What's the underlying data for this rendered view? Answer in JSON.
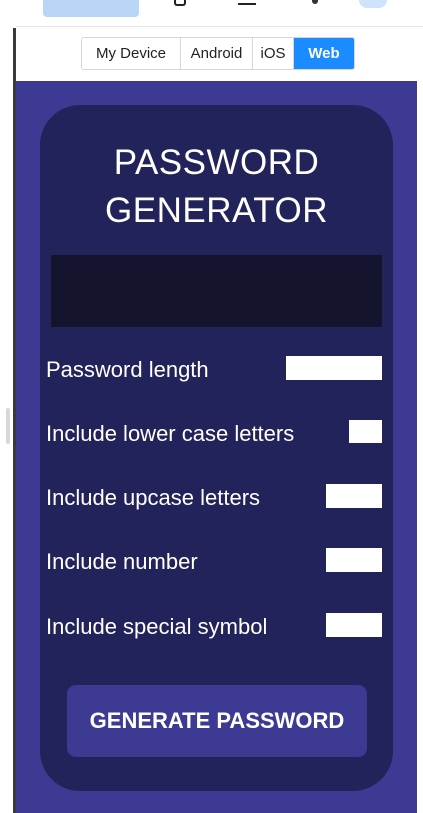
{
  "device_selector": {
    "options": [
      "My Device",
      "Android",
      "iOS",
      "Web"
    ],
    "selected": "Web"
  },
  "app": {
    "title_line1": "PASSWORD",
    "title_line2": "GENERATOR",
    "password_output": "",
    "options": {
      "length_label": "Password length",
      "lowercase_label": "Include lower case letters",
      "upcase_label": "Include upcase letters",
      "number_label": "Include number",
      "symbol_label": "Include special symbol"
    },
    "generate_button": "GENERATE PASSWORD"
  },
  "colors": {
    "viewport_bg": "#3c3a93",
    "card_bg": "#23235b",
    "output_bg": "#15142f",
    "active_segment": "#1a8cff"
  }
}
